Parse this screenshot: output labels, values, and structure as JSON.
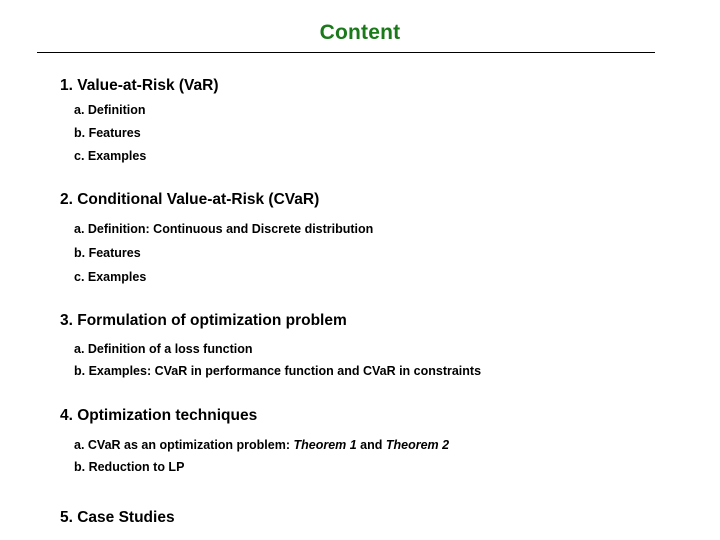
{
  "slide": {
    "title": "Content",
    "title_color": "#1a7a1a",
    "background_color": "#ffffff",
    "text_color": "#000000",
    "rule_color": "#000000"
  },
  "outline": [
    {
      "heading": "1. Value-at-Risk (VaR)",
      "items": [
        {
          "text": "a. Definition"
        },
        {
          "text": "b. Features"
        },
        {
          "text": "c. Examples"
        }
      ]
    },
    {
      "heading": "2. Conditional Value-at-Risk (CVaR)",
      "items": [
        {
          "text": "a. Definition: Continuous and Discrete distribution"
        },
        {
          "text": "b. Features"
        },
        {
          "text": "c. Examples"
        }
      ]
    },
    {
      "heading": "3. Formulation of optimization problem",
      "items": [
        {
          "text": "a. Definition of a loss function"
        },
        {
          "text": "b. Examples: CVaR in performance function and CVaR in constraints"
        }
      ]
    },
    {
      "heading": "4. Optimization techniques",
      "items": [
        {
          "prefix": "a. CVaR as an optimization problem: ",
          "italic1": "Theorem 1",
          "middle": " and ",
          "italic2": "Theorem 2"
        },
        {
          "text": "b. Reduction to LP"
        }
      ]
    },
    {
      "heading": "5. Case Studies",
      "items": []
    }
  ]
}
